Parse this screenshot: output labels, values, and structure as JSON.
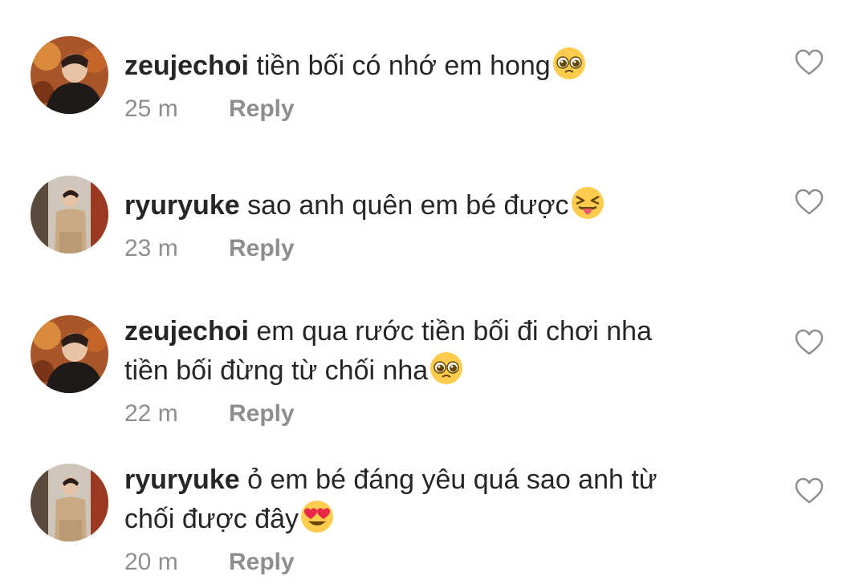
{
  "actions": {
    "reply_label": "Reply",
    "like_icon": "heart-outline-icon"
  },
  "comments": [
    {
      "username": "zeujechoi",
      "lines": [
        "tiền bối có nhớ em hong"
      ],
      "emoji": "pleading-face-emoji",
      "time": "25 m"
    },
    {
      "username": "ryuryuke",
      "lines": [
        "sao anh quên em bé được"
      ],
      "emoji": "squinting-tongue-face-emoji",
      "time": "23 m"
    },
    {
      "username": "zeujechoi",
      "lines": [
        "em qua rước tiền bối đi chơi nha",
        "tiền bối đừng từ chối nha"
      ],
      "emoji": "pleading-face-emoji",
      "time": "22 m"
    },
    {
      "username": "ryuryuke",
      "lines": [
        "ỏ em bé đáng yêu quá sao anh từ",
        "chối được đây"
      ],
      "emoji": "heart-eyes-face-emoji",
      "time": "20 m"
    }
  ]
}
